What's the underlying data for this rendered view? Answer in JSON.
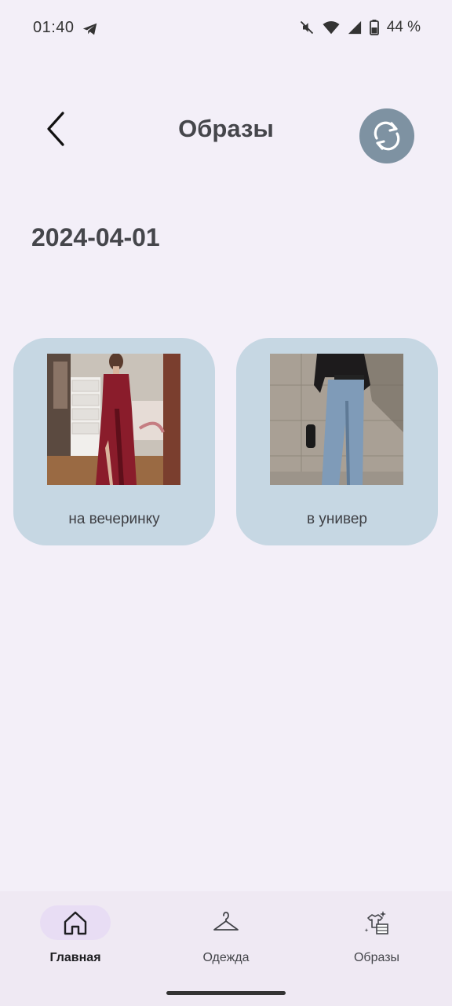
{
  "status_bar": {
    "time": "01:40",
    "battery": "44 %"
  },
  "header": {
    "title": "Образы",
    "back_icon": "back-arrow-icon",
    "refresh_icon": "sync-icon",
    "refresh_color": "#7e92a2"
  },
  "date": "2024-04-01",
  "outfits": [
    {
      "label": "на вечеринку",
      "image": "burgundy-satin-dress-photo"
    },
    {
      "label": "в универ",
      "image": "wide-leg-jeans-black-jacket-photo"
    }
  ],
  "bottom_nav": {
    "items": [
      {
        "label": "Главная",
        "icon": "home-icon",
        "active": true
      },
      {
        "label": "Одежда",
        "icon": "hanger-icon",
        "active": false
      },
      {
        "label": "Образы",
        "icon": "outfits-icon",
        "active": false
      }
    ]
  },
  "colors": {
    "background": "#f3eff8",
    "card": "#c6d7e3",
    "nav_active_pill": "#e8ddf4"
  }
}
